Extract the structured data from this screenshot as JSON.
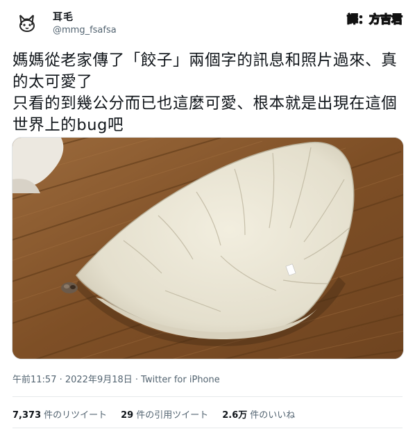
{
  "user": {
    "display_name": "耳毛",
    "handle": "@mmg_fsafsa"
  },
  "watermark": "譯：方吉君",
  "tweet": {
    "text": "媽媽從老家傳了「餃子」兩個字的訊息和照片過來、真的太可愛了\n只看的到幾公分而已也這麼可愛、根本就是出現在這個世界上的bug吧"
  },
  "timestamp": "午前11:57 · 2022年9月18日 · Twitter for iPhone",
  "stats": {
    "retweets_count": "7,373",
    "retweets_label": "件のリツイート",
    "quotes_count": "29",
    "quotes_label": "件の引用ツイート",
    "likes_count": "2.6万",
    "likes_label": "件のいいね"
  },
  "colors": {
    "text": "#0f1419",
    "secondary": "#536471",
    "floor": "#8a5a2f",
    "cushion": "#e9e4d4"
  },
  "icons": {
    "avatar": "cat-face-icon"
  }
}
